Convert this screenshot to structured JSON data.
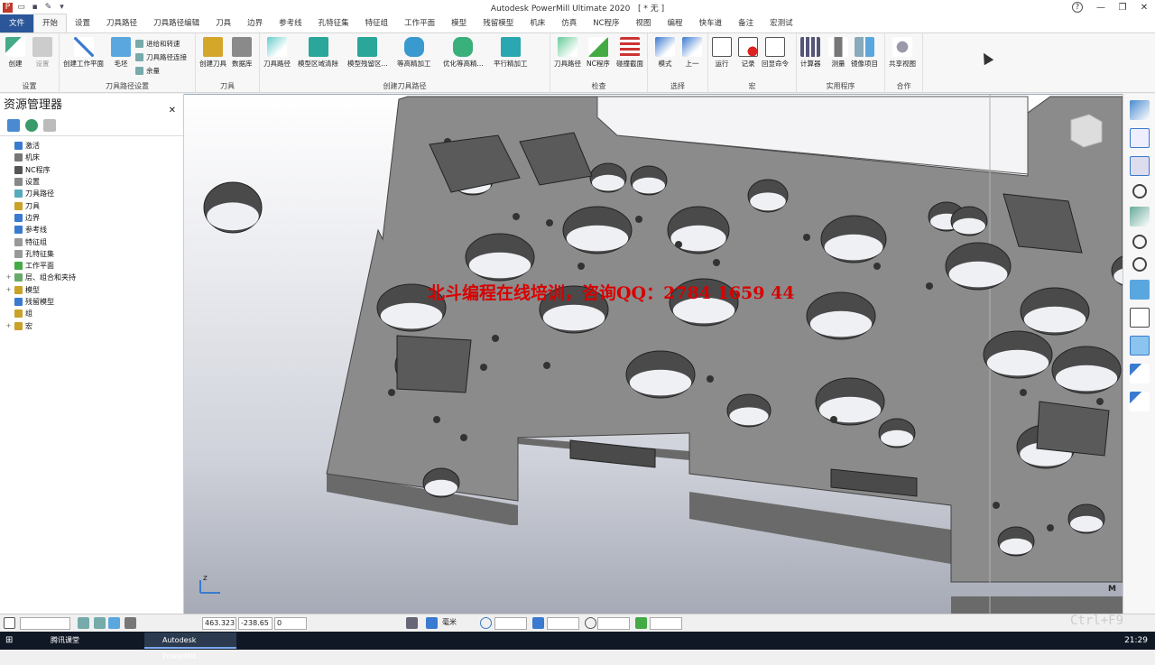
{
  "app": {
    "title": "Autodesk PowerMill Ultimate 2020",
    "doc": "[ * 无 ]",
    "help": "?"
  },
  "tabs": [
    "文件",
    "开始",
    "设置",
    "刀具路径",
    "刀具路径编辑",
    "刀具",
    "边界",
    "参考线",
    "孔特征集",
    "特征组",
    "工作平面",
    "模型",
    "残留模型",
    "机床",
    "仿真",
    "NC程序",
    "视图",
    "编程",
    "快车道",
    "备注",
    "宏测试"
  ],
  "ribbon": {
    "groups": [
      {
        "label": "设置",
        "buttons": [
          "创建",
          "设置"
        ]
      },
      {
        "label": "刀具路径设置",
        "buttons": [
          "创建工作平面",
          "毛坯"
        ],
        "small": [
          "进给和转速",
          "刀具路径连接",
          "余量"
        ]
      },
      {
        "label": "刀具",
        "buttons": [
          "创建刀具",
          "数据库"
        ]
      },
      {
        "label": "创建刀具路径",
        "buttons": [
          "刀具路径",
          "模型区域清除",
          "模型残留区...",
          "等高精加工",
          "优化等高精...",
          "平行精加工"
        ]
      },
      {
        "label": "检查",
        "buttons": [
          "刀具路径",
          "NC程序",
          "碰撞截面"
        ]
      },
      {
        "label": "选择",
        "buttons": [
          "模式",
          "上一"
        ]
      },
      {
        "label": "宏",
        "buttons": [
          "运行",
          "记录",
          "回显命令"
        ]
      },
      {
        "label": "实用程序",
        "buttons": [
          "计算器",
          "测量",
          "镜像项目"
        ]
      },
      {
        "label": "合作",
        "buttons": [
          "共享视图"
        ]
      }
    ]
  },
  "explorer": {
    "title": "资源管理器",
    "items": [
      {
        "label": "激活",
        "color": "#3a7ad0",
        "expand": ""
      },
      {
        "label": "机床",
        "color": "#777",
        "expand": ""
      },
      {
        "label": "NC程序",
        "color": "#555",
        "expand": ""
      },
      {
        "label": "设置",
        "color": "#888",
        "expand": ""
      },
      {
        "label": "刀具路径",
        "color": "#5ab",
        "expand": ""
      },
      {
        "label": "刀具",
        "color": "#c9a227",
        "expand": ""
      },
      {
        "label": "边界",
        "color": "#3a7ad0",
        "expand": ""
      },
      {
        "label": "参考线",
        "color": "#3a7ad0",
        "expand": ""
      },
      {
        "label": "特征组",
        "color": "#999",
        "expand": ""
      },
      {
        "label": "孔特征集",
        "color": "#999",
        "expand": ""
      },
      {
        "label": "工作平面",
        "color": "#4a4",
        "expand": ""
      },
      {
        "label": "层、组合和夹持",
        "color": "#6a6",
        "expand": "+"
      },
      {
        "label": "模型",
        "color": "#c9a227",
        "expand": "+"
      },
      {
        "label": "残留模型",
        "color": "#3a7ad0",
        "expand": ""
      },
      {
        "label": "组",
        "color": "#c9a227",
        "expand": ""
      },
      {
        "label": "宏",
        "color": "#c9a227",
        "expand": "+"
      }
    ]
  },
  "viewport": {
    "watermark": "北斗编程在线培训，咨询QQ：2784 1659 44",
    "axis_label": "z",
    "corner_text": "M"
  },
  "status": {
    "x": "463.323",
    "y": "-238.65",
    "z": "0",
    "unit": "毫米",
    "shortcut": "Ctrl+F9"
  },
  "taskbar": {
    "items": [
      "腾讯课堂",
      "Autodesk PowerMill..."
    ],
    "clock": "21:29"
  },
  "colors": {
    "file_tab": "#2b579a",
    "plate_top": "#8a8a8a",
    "plate_side": "#6a6a6a",
    "watermark": "#d90000"
  }
}
